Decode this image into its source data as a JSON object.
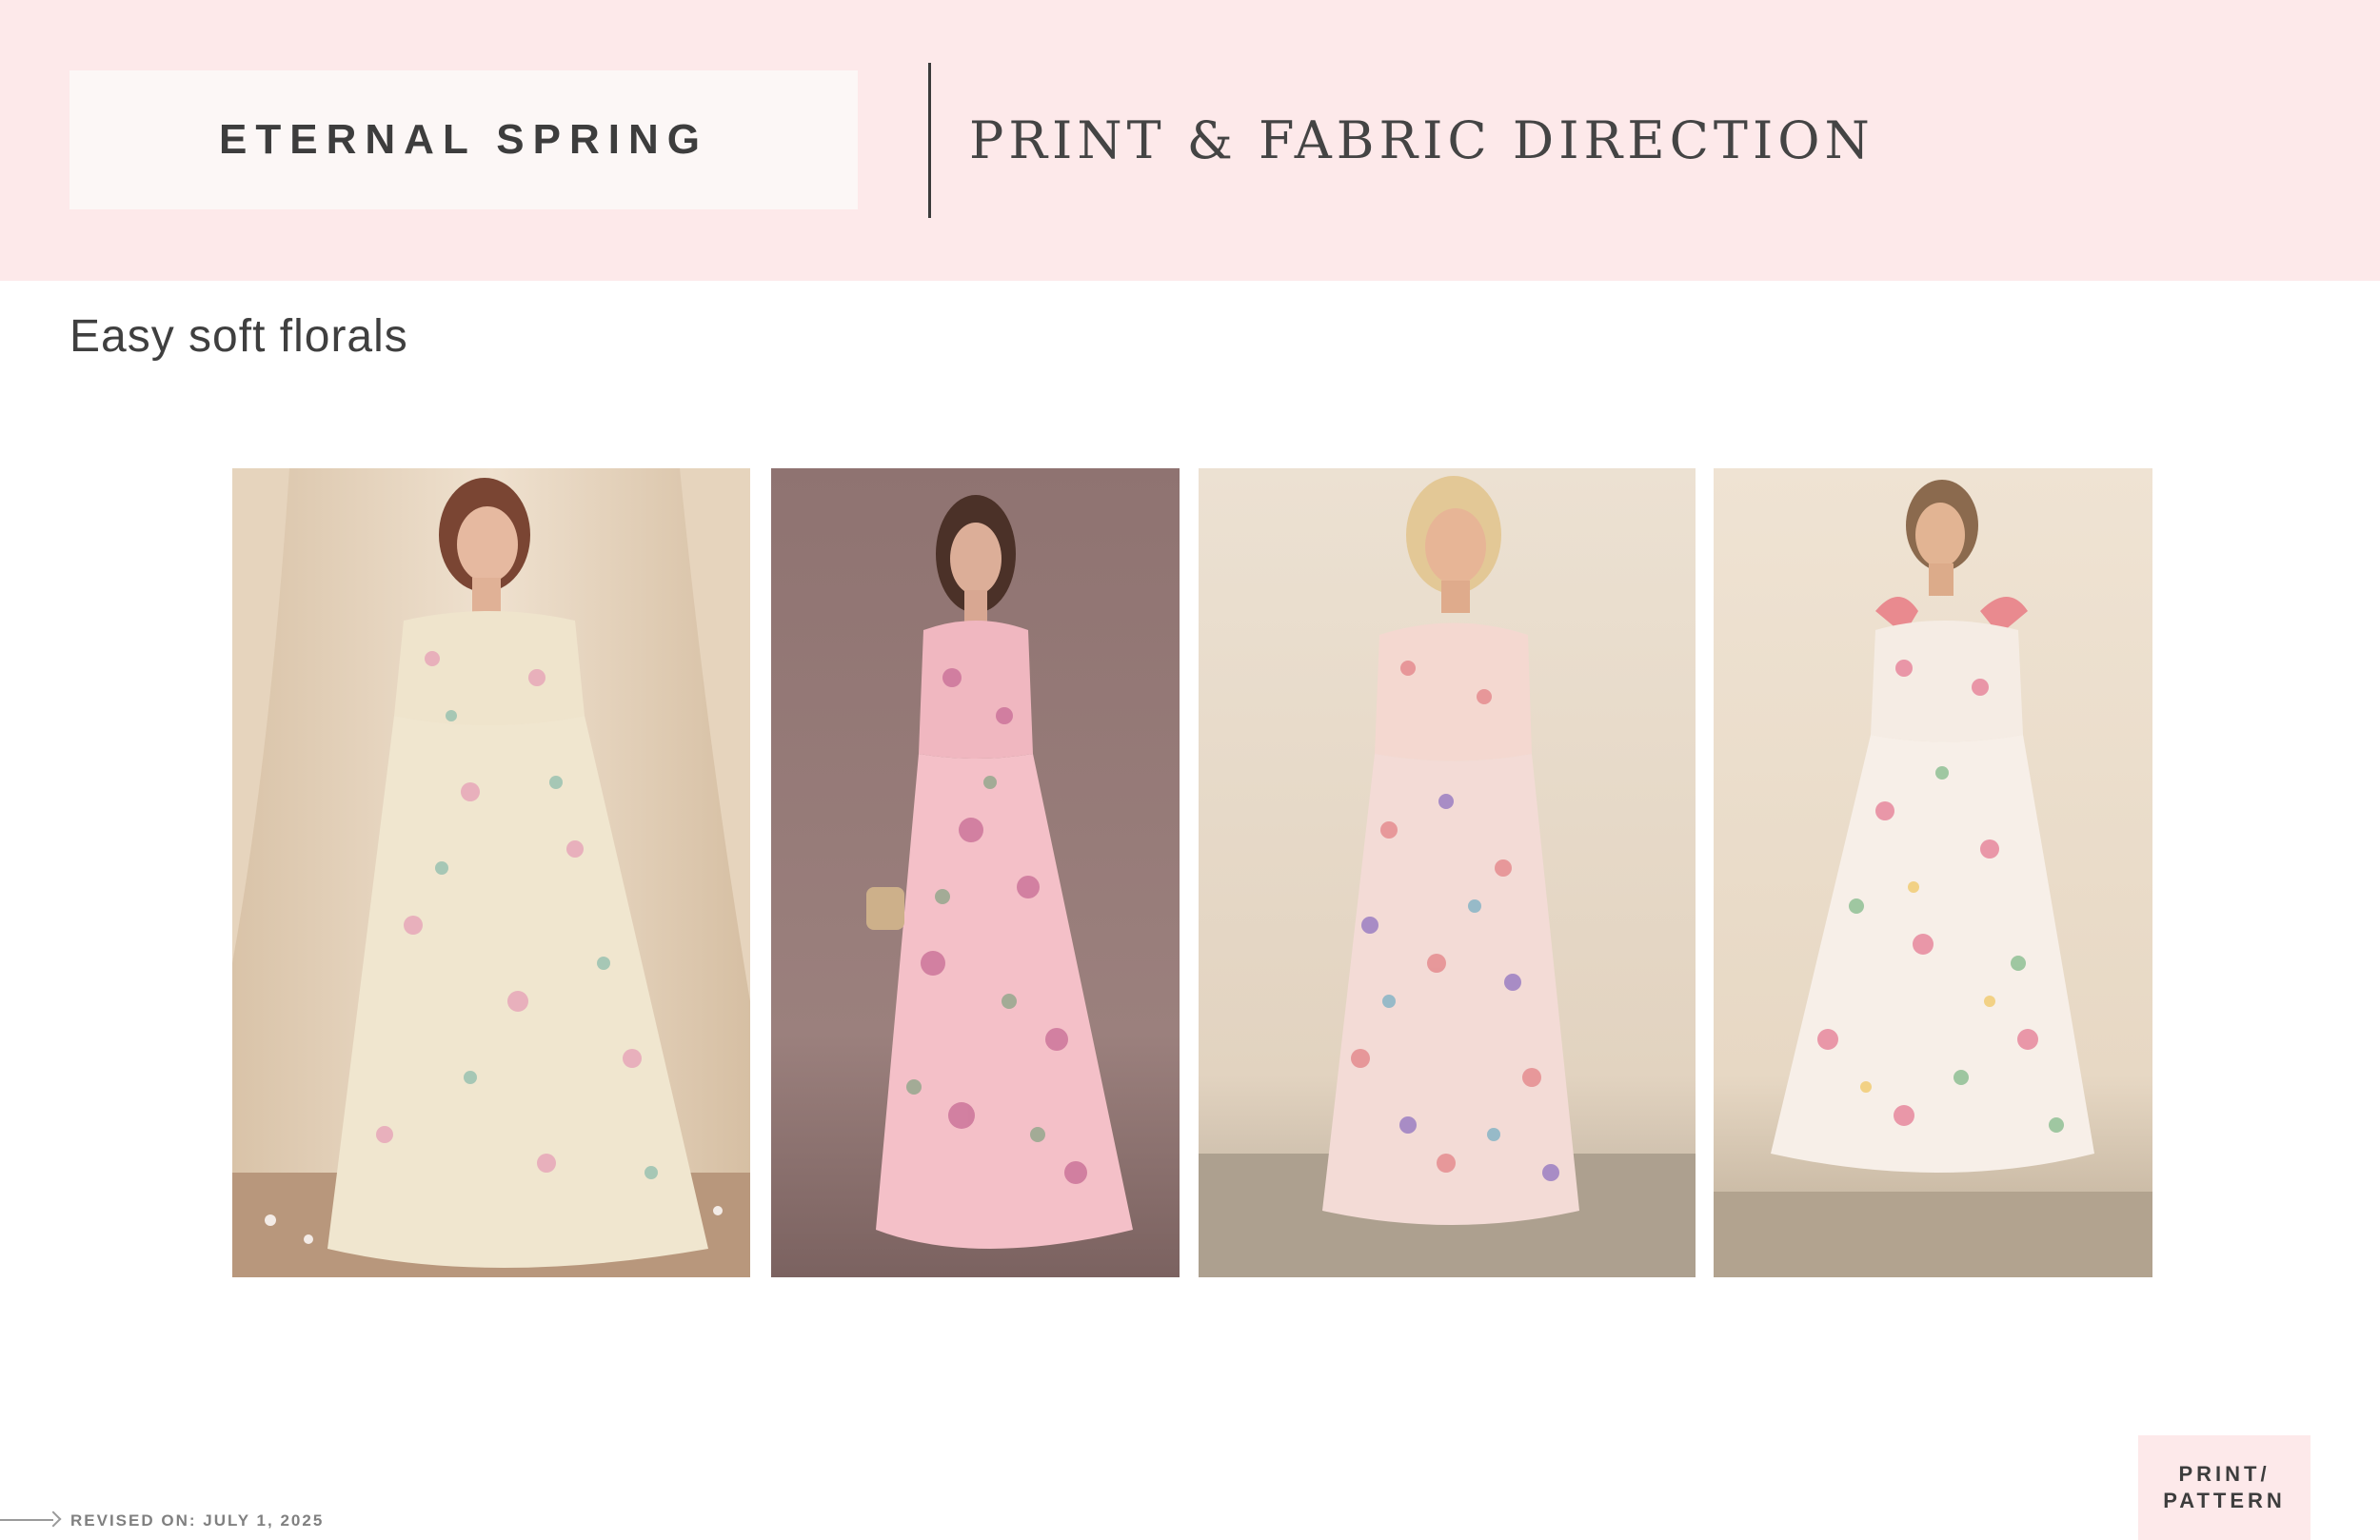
{
  "header": {
    "collection_title": "ETERNAL SPRING",
    "page_subtitle": "PRINT & FABRIC DIRECTION"
  },
  "section": {
    "heading": "Easy soft florals"
  },
  "photos": [
    {
      "name": "photo-ruffled-cream-floral-maxi-dress"
    },
    {
      "name": "photo-pink-floral-corset-maxi-dress"
    },
    {
      "name": "photo-embroidered-floral-midi-dress"
    },
    {
      "name": "photo-tie-strap-tiered-floral-midi-dress"
    }
  ],
  "footer": {
    "revised": "REVISED ON: JULY 1, 2025",
    "tag_line1": "PRINT/",
    "tag_line2": "PATTERN"
  },
  "colors": {
    "header_bg": "#fde9ea",
    "title_box_bg": "#fcf7f6",
    "text_dark": "#3d3d3d"
  }
}
